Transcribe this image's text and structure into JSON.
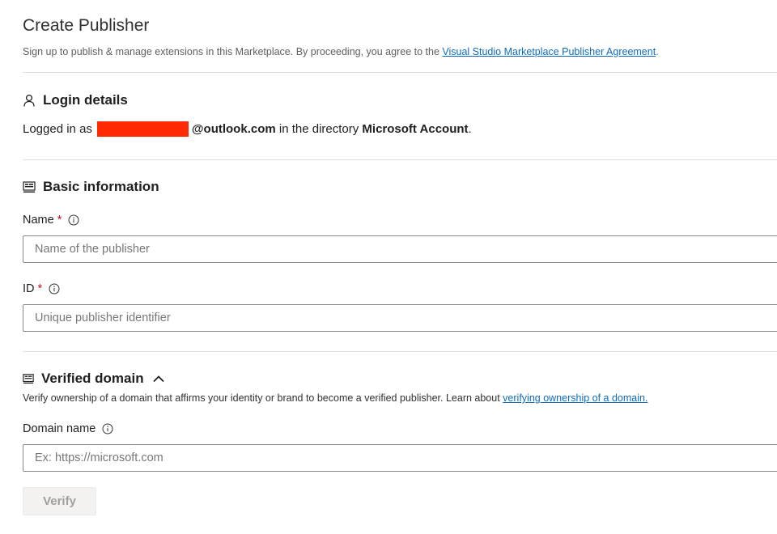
{
  "header": {
    "title": "Create Publisher",
    "subtitle_text": "Sign up to publish & manage extensions in this Marketplace. By proceeding, you agree to the ",
    "agreement_link": "Visual Studio Marketplace Publisher Agreement",
    "subtitle_end": "."
  },
  "login": {
    "heading": "Login details",
    "prefix": "Logged in as",
    "email_suffix": "@outlook.com",
    "middle": " in the directory ",
    "directory": "Microsoft Account",
    "end": "."
  },
  "basic": {
    "heading": "Basic information",
    "name_label": "Name",
    "name_placeholder": "Name of the publisher",
    "id_label": "ID",
    "id_placeholder": "Unique publisher identifier",
    "required_mark": "*"
  },
  "domain": {
    "heading": "Verified domain",
    "description": "Verify ownership of a domain that affirms your identity or brand to become a verified publisher. Learn about ",
    "learn_link": "verifying ownership of a domain.",
    "field_label": "Domain name",
    "placeholder": "Ex: https://microsoft.com",
    "verify_label": "Verify"
  },
  "colors": {
    "link": "#0f6cbd",
    "required": "#c50f1f",
    "redaction": "#ff2a00"
  },
  "icons": {
    "login": "person-icon",
    "basic": "form-icon",
    "domain": "form-icon",
    "info": "info-icon",
    "collapse": "chevron-up-icon"
  }
}
